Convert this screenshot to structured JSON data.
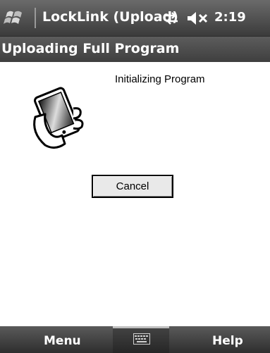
{
  "titlebar": {
    "title": "LockLink (Upload)",
    "clock": "2:19",
    "icons": [
      "windows-start-icon",
      "connectivity-icon",
      "volume-muted-icon"
    ]
  },
  "caption": {
    "text": "Uploading Full Program"
  },
  "content": {
    "status": "Initializing Program",
    "cancel_label": "Cancel",
    "icon": "handheld-device-icon"
  },
  "menubar": {
    "left_label": "Menu",
    "right_label": "Help",
    "icon": "keyboard-icon"
  },
  "colors": {
    "bar_dark": "#3b3b3b",
    "bar_light": "#6a6a6a",
    "background": "#ffffff"
  }
}
